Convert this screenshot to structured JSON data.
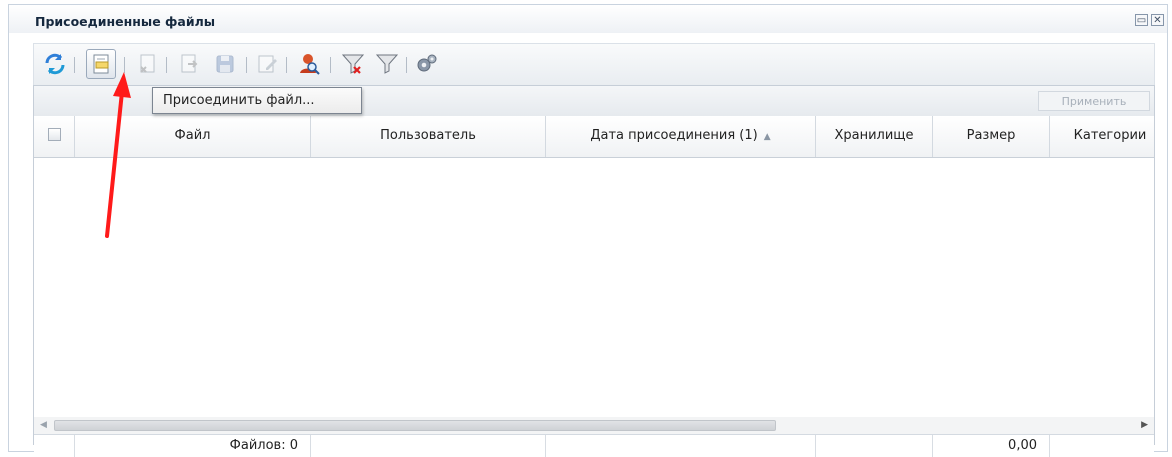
{
  "window": {
    "title": "Присоединенные файлы"
  },
  "toolbar": {
    "buttons": [
      {
        "name": "refresh-icon"
      },
      {
        "name": "attach-file-icon"
      },
      {
        "name": "delete-file-icon"
      },
      {
        "name": "export-file-icon"
      },
      {
        "name": "save-icon"
      },
      {
        "name": "edit-icon"
      },
      {
        "name": "user-search-icon"
      },
      {
        "name": "clear-filter-icon"
      },
      {
        "name": "filter-icon"
      },
      {
        "name": "settings-icon"
      }
    ],
    "tooltip": "Присоединить файл...",
    "apply_label": "Применить"
  },
  "table": {
    "columns": [
      {
        "label": "Файл"
      },
      {
        "label": "Пользователь"
      },
      {
        "label": "Дата присоединения (1)"
      },
      {
        "label": "Хранилище"
      },
      {
        "label": "Размер"
      },
      {
        "label": "Категории"
      }
    ],
    "sort_indicator": "▲",
    "footer": {
      "files_count": "Файлов: 0",
      "size_total": "0,00"
    }
  },
  "colors": {
    "annotation_arrow": "#ff1a1a",
    "accent": "#15283e"
  }
}
